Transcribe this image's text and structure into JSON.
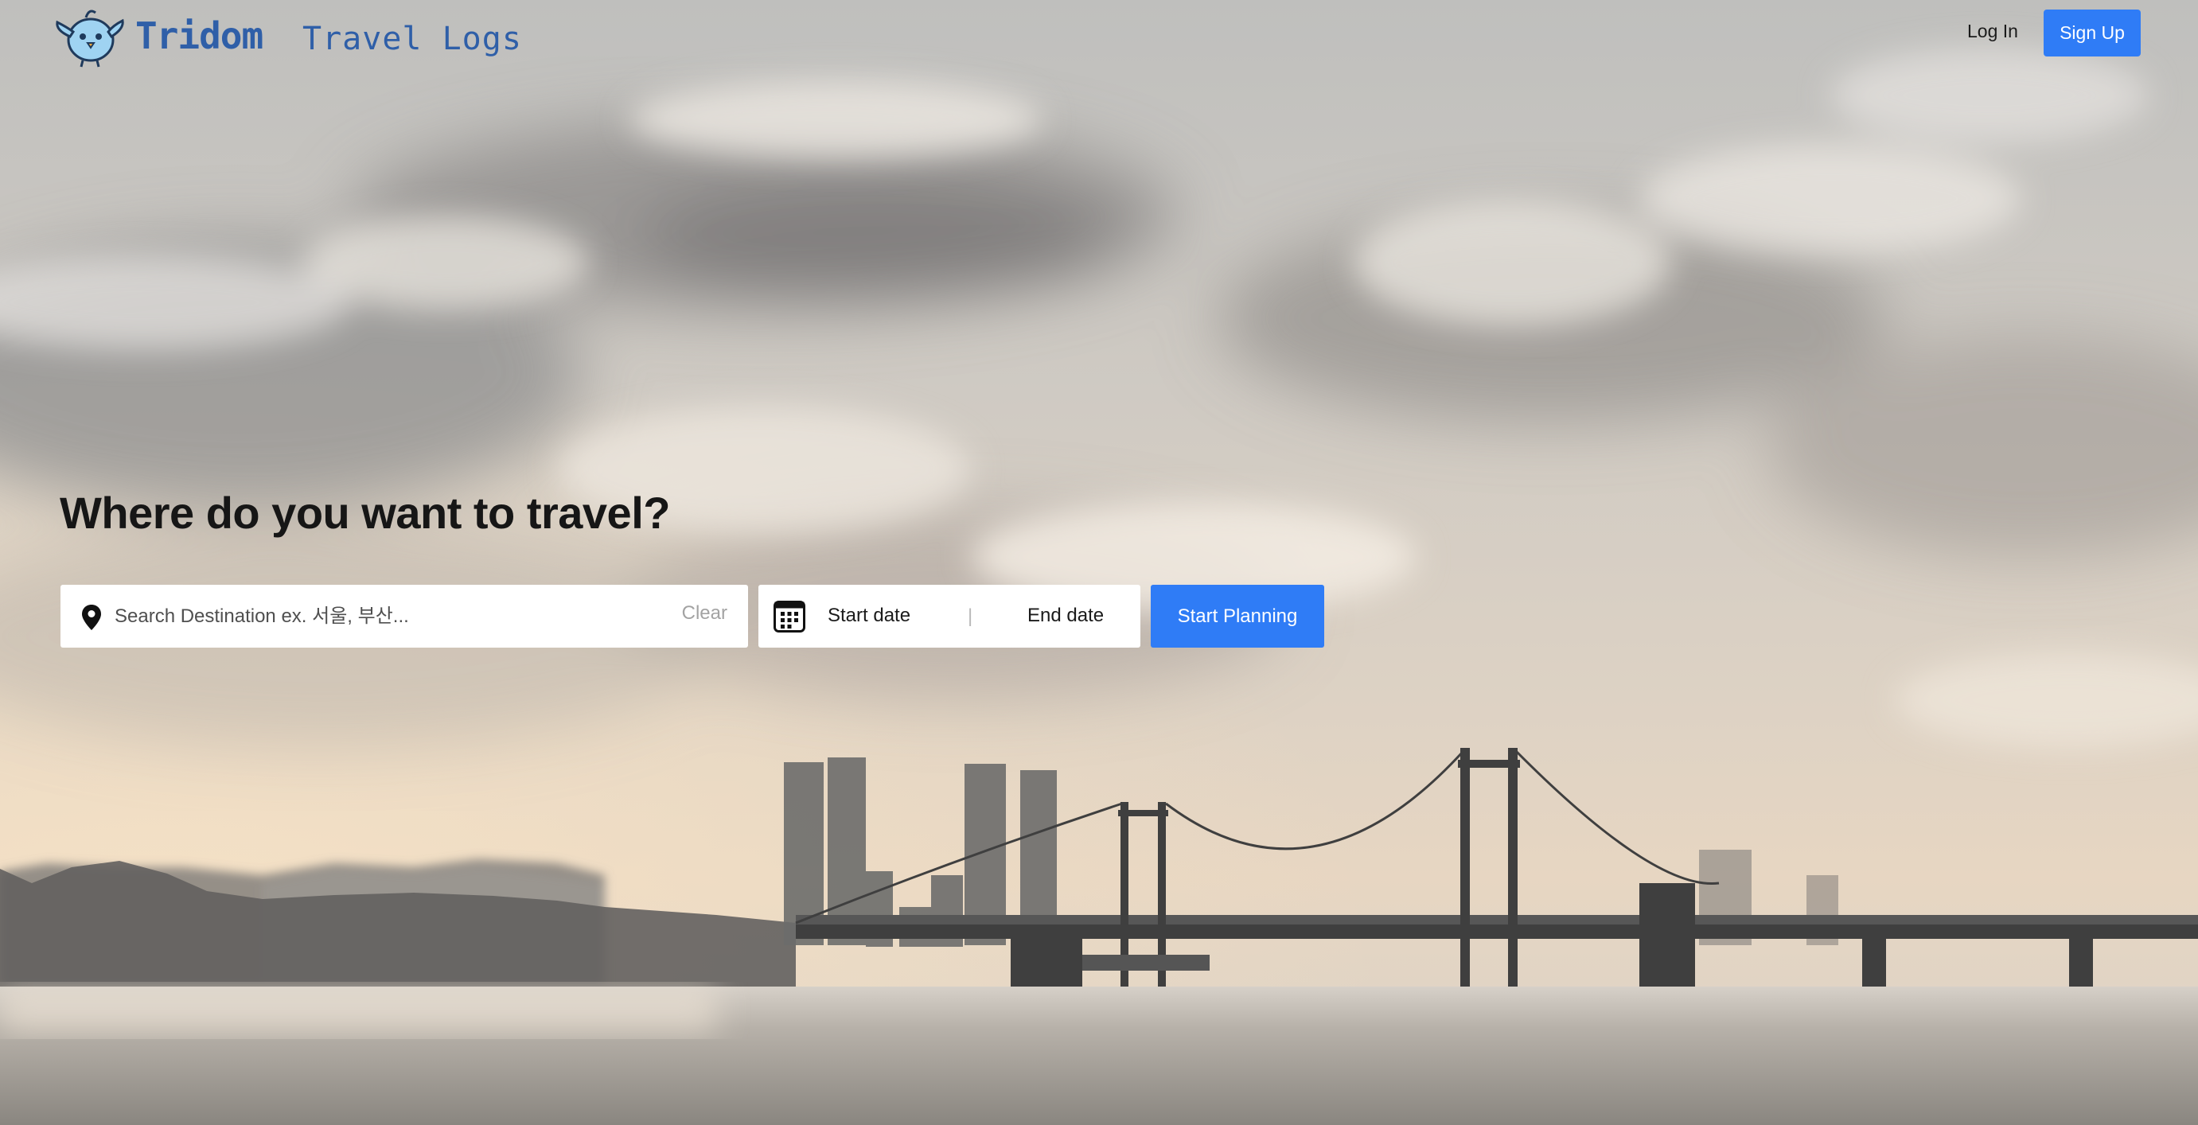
{
  "header": {
    "brand": "Tridom",
    "section_link": "Travel Logs",
    "login_label": "Log In",
    "signup_label": "Sign Up"
  },
  "hero": {
    "headline": "Where do you want to travel?",
    "search": {
      "placeholder": "Search Destination ex. 서울, 부산...",
      "clear_label": "Clear",
      "value": ""
    },
    "dates": {
      "start_label": "Start date",
      "separator": "|",
      "end_label": "End date"
    },
    "cta_label": "Start Planning"
  },
  "colors": {
    "accent": "#2f7cf6",
    "brand": "#2f5fa8",
    "headline": "#161616"
  },
  "icons": {
    "logo": "bird-mascot-icon",
    "location": "map-pin-icon",
    "calendar": "calendar-icon"
  }
}
